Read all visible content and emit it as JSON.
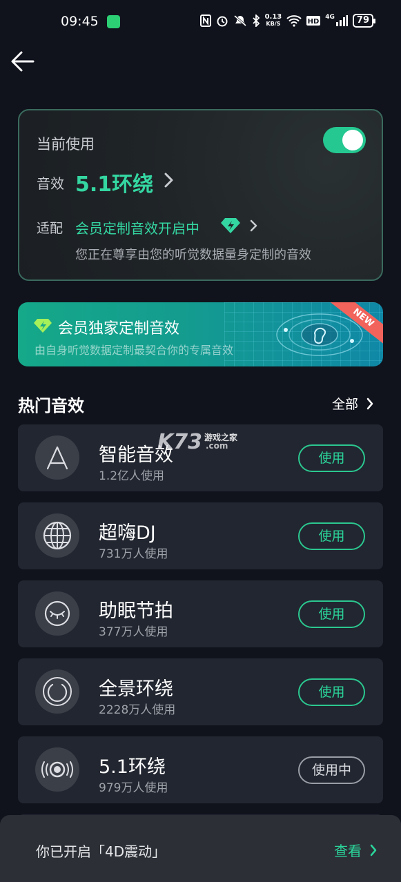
{
  "status_bar": {
    "time": "09:45",
    "speed_value": "0.13",
    "speed_unit": "KB/S",
    "battery": "79",
    "network": "4G"
  },
  "current": {
    "title": "当前使用",
    "toggle_on": true,
    "effect_label": "音效",
    "effect_value": "5.1环绕",
    "adapt_label": "适配",
    "adapt_value": "会员定制音效开启中",
    "description": "您正在尊享由您的听觉数据量身定制的音效"
  },
  "banner": {
    "title": "会员独家定制音效",
    "subtitle": "由自身听觉数据定制最契合你的专属音效",
    "badge": "NEW"
  },
  "section": {
    "title": "热门音效",
    "all_label": "全部"
  },
  "effects": [
    {
      "name": "智能音效",
      "count": "1.2亿人使用",
      "button": "使用",
      "icon": "a-letter-icon"
    },
    {
      "name": "超嗨DJ",
      "count": "731万人使用",
      "button": "使用",
      "icon": "globe-icon"
    },
    {
      "name": "助眠节拍",
      "count": "377万人使用",
      "button": "使用",
      "icon": "sleep-eye-icon"
    },
    {
      "name": "全景环绕",
      "count": "2228万人使用",
      "button": "使用",
      "icon": "panorama-ring-icon"
    },
    {
      "name": "5.1环绕",
      "count": "979万人使用",
      "button": "使用中",
      "icon": "speaker-icon"
    }
  ],
  "watermark": {
    "k73": "K73",
    "cn": "游戏之家",
    "com": ".com"
  },
  "bottom_bar": {
    "text": "你已开启「4D震动」",
    "link": "查看"
  },
  "colors": {
    "accent": "#2bd49a",
    "background": "#10131c",
    "card": "#222630"
  }
}
